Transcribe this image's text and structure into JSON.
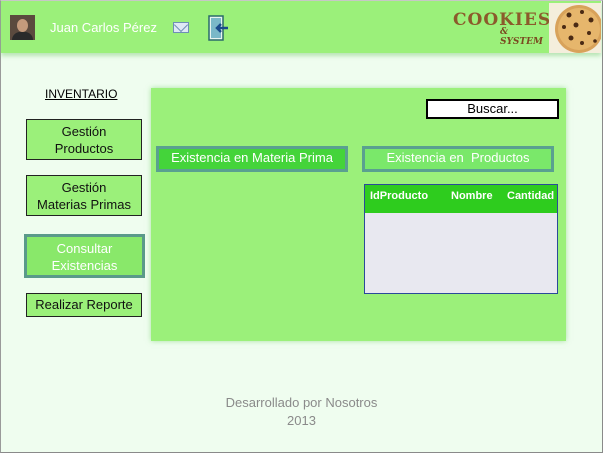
{
  "header": {
    "user_name": "Juan Carlos Pérez",
    "logo_title": "COOKIES",
    "logo_subtitle": "& SYSTEM",
    "icons": {
      "avatar": "user-avatar",
      "mail": "mail-icon",
      "exit": "exit-door-icon",
      "cookie": "cookie-icon"
    }
  },
  "sidebar": {
    "title": "INVENTARIO",
    "items": [
      {
        "label": "Gestión Productos",
        "line1": "Gestión",
        "line2": "Productos"
      },
      {
        "label": "Gestión Materias Primas",
        "line1": "Gestión",
        "line2": "Materias Primas"
      },
      {
        "label": "Consultar Existencias",
        "line1": "Consultar",
        "line2": "Existencias",
        "active": true
      },
      {
        "label": "Realizar Reporte"
      }
    ]
  },
  "main": {
    "search_label": "Buscar...",
    "tabs": [
      {
        "label": "Existencia en Materia Prima"
      },
      {
        "label": "Existencia en  Productos",
        "active": true
      }
    ],
    "table": {
      "columns": [
        "IdProducto",
        "Nombre",
        "Cantidad"
      ],
      "rows": []
    }
  },
  "footer": {
    "line1": "Desarrollado por Nosotros",
    "line2": "2013"
  },
  "colors": {
    "background": "#effdef",
    "green_light": "#9bf07a",
    "green_dark": "#2ecc1e",
    "border_teal": "#5aa090"
  }
}
